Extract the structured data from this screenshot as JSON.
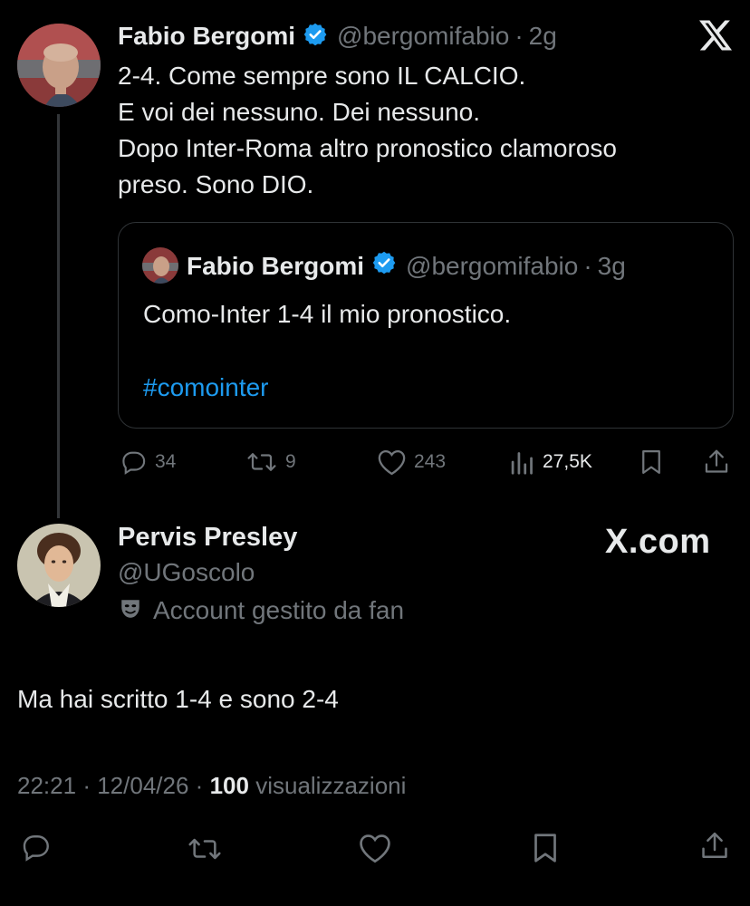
{
  "parent_tweet": {
    "display_name": "Fabio Bergomi",
    "handle": "@bergomifabio",
    "separator": "·",
    "time": "2g",
    "text": "2-4. Come sempre sono IL CALCIO.\nE voi dei nessuno. Dei nessuno.\nDopo Inter-Roma altro pronostico clamoroso\npreso. Sono DIO.",
    "quoted": {
      "display_name": "Fabio Bergomi",
      "handle": "@bergomifabio",
      "separator": "·",
      "time": "3g",
      "text": "Como-Inter 1-4 il mio pronostico.",
      "hashtag": "#comointer"
    },
    "actions": {
      "replies": "34",
      "reposts": "9",
      "likes": "243",
      "views": "27,5K"
    }
  },
  "reply_tweet": {
    "display_name": "Pervis Presley",
    "handle": "@UGoscolo",
    "label": "Account gestito da fan",
    "text": "Ma hai scritto 1-4 e sono 2-4",
    "time": "22:21",
    "date": "12/04/26",
    "views_count": "100",
    "views_label": "visualizzazioni",
    "separator": "·"
  },
  "brand": {
    "watermark": "X.com",
    "accent": "#1d9bf0",
    "background": "#000000",
    "muted": "#71767b"
  },
  "icons": [
    "x-logo-icon",
    "verified-badge-icon",
    "reply-icon",
    "repost-icon",
    "like-icon",
    "views-icon",
    "bookmark-icon",
    "share-icon",
    "fan-mask-icon"
  ]
}
